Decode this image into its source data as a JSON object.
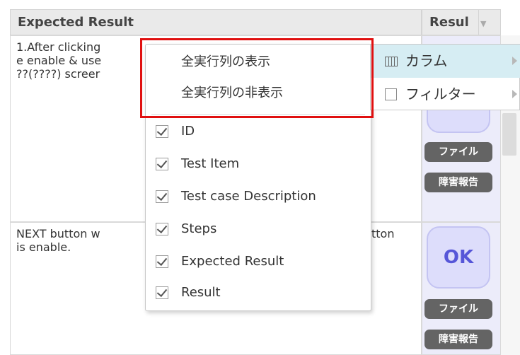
{
  "table": {
    "headers": {
      "expected_result": "Expected Result",
      "result": "Resul"
    },
    "rows": [
      {
        "expected_lines": [
          "1.After clicking",
          "e enable & use",
          "??(????) screer"
        ]
      },
      {
        "expected_lines": [
          "NEXT button w",
          "is enable."
        ],
        "trailing": "tton"
      }
    ],
    "result_buttons": [
      "OK"
    ],
    "pill_file": "ファイル",
    "pill_bug": "障害報告"
  },
  "context_menu": {
    "show_all": "全実行列の表示",
    "hide_all": "全実行列の非表示",
    "columns": [
      "ID",
      "Test Item",
      "Test case Description",
      "Steps",
      "Expected Result",
      "Result"
    ]
  },
  "submenu": {
    "columns": "カラム",
    "filter": "フィルター"
  },
  "colors": {
    "highlight_red": "#e01010",
    "ok_purple": "#5656d8",
    "submenu_hover": "#d6edf3"
  }
}
